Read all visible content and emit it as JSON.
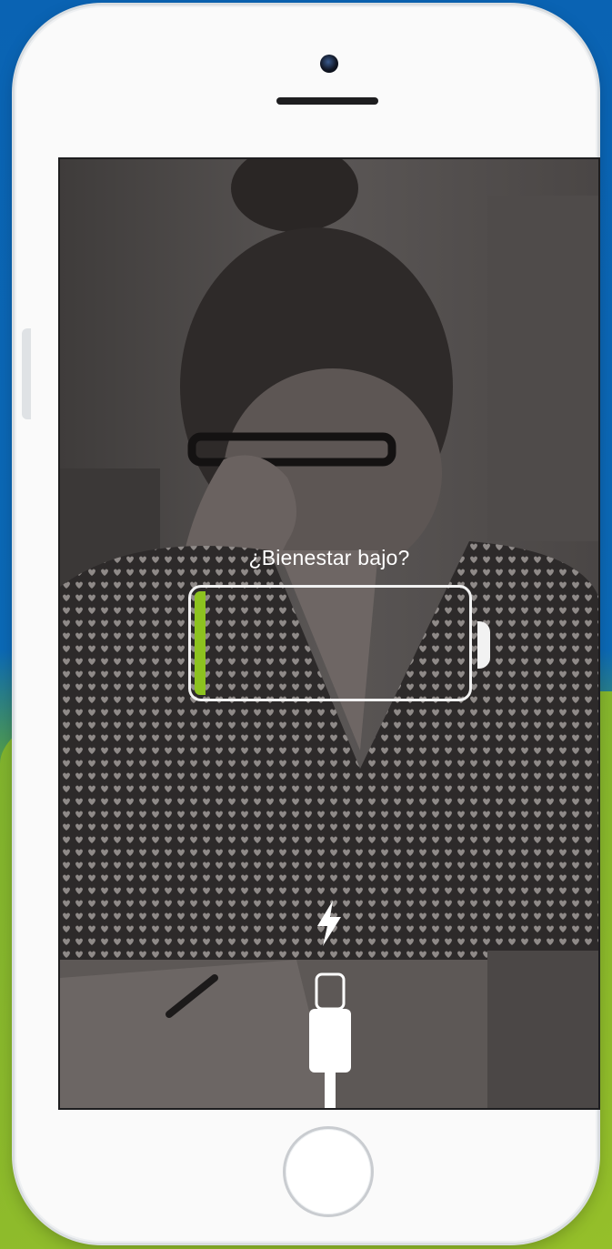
{
  "lock_screen": {
    "message": "¿Bienestar bajo?",
    "battery_level": 0.04
  },
  "colors": {
    "background_top": "#0a63b3",
    "background_bottom": "#88b82a",
    "battery_fill": "#8dc21f",
    "battery_outline": "#f2f2f2",
    "screen_tint": "#4d4a49"
  },
  "icons": [
    "camera-icon",
    "speaker-grille-icon",
    "lightning-bolt-icon",
    "lightning-cable-icon",
    "home-button-icon"
  ]
}
